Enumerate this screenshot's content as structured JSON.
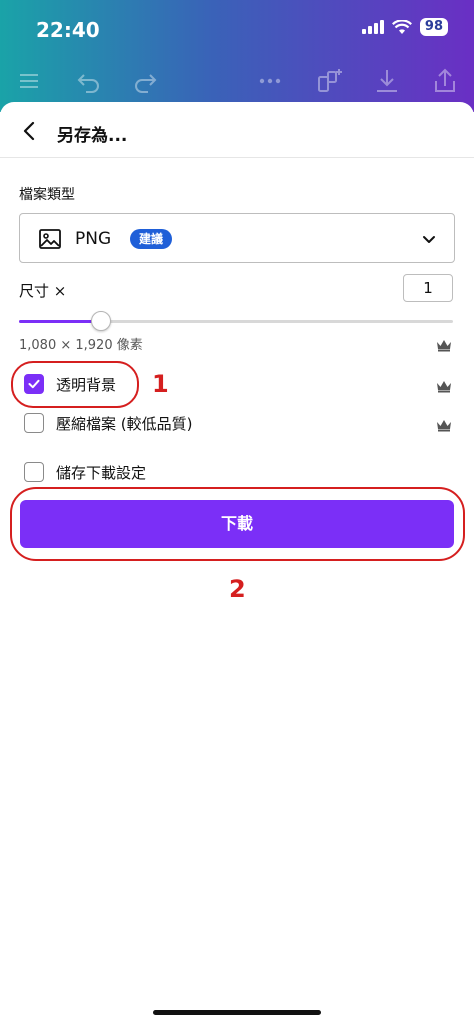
{
  "status_bar": {
    "time": "22:40",
    "battery": "98"
  },
  "sheet": {
    "title": "另存為...",
    "file_type_label": "檔案類型",
    "file_type_value": "PNG",
    "recommended_badge": "建議",
    "size_label": "尺寸 ×",
    "size_value": "1",
    "slider_fraction": 0.19,
    "dimensions": "1,080 × 1,920 像素"
  },
  "options": [
    {
      "label": "透明背景",
      "checked": true
    },
    {
      "label": "壓縮檔案 (較低品質)",
      "checked": false
    },
    {
      "label": "儲存下載設定",
      "checked": false
    }
  ],
  "download_label": "下載",
  "annotations": {
    "one": "1",
    "two": "2"
  },
  "colors": {
    "accent": "#7b2ff7",
    "badge": "#1f5fd8",
    "annotation": "#d51f1f"
  },
  "icons": [
    "menu-icon",
    "undo-icon",
    "redo-icon",
    "more-icon",
    "add-page-icon",
    "download-icon",
    "share-icon",
    "back-icon",
    "image-icon",
    "chevron-down-icon",
    "crown-icon",
    "check-icon"
  ]
}
